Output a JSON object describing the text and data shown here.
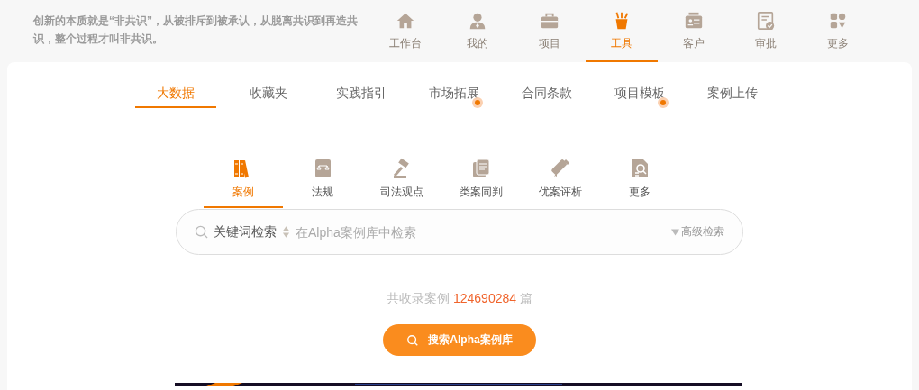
{
  "header": {
    "quote": "创新的本质就是“非共识”，从被排斥到被承认，从脱离共识到再造共识，整个过程才叫非共识。"
  },
  "top_nav": [
    {
      "label": "工作台",
      "selected": false
    },
    {
      "label": "我的",
      "selected": false
    },
    {
      "label": "项目",
      "selected": false
    },
    {
      "label": "工具",
      "selected": true
    },
    {
      "label": "客户",
      "selected": false
    },
    {
      "label": "审批",
      "selected": false
    },
    {
      "label": "更多",
      "selected": false
    }
  ],
  "tabs": [
    {
      "label": "大数据",
      "selected": true,
      "dot": false
    },
    {
      "label": "收藏夹",
      "selected": false,
      "dot": false
    },
    {
      "label": "实践指引",
      "selected": false,
      "dot": false
    },
    {
      "label": "市场拓展",
      "selected": false,
      "dot": true
    },
    {
      "label": "合同条款",
      "selected": false,
      "dot": false
    },
    {
      "label": "项目模板",
      "selected": false,
      "dot": true
    },
    {
      "label": "案例上传",
      "selected": false,
      "dot": false
    }
  ],
  "categories": [
    {
      "label": "案例",
      "selected": true
    },
    {
      "label": "法规",
      "selected": false
    },
    {
      "label": "司法观点",
      "selected": false
    },
    {
      "label": "类案同判",
      "selected": false
    },
    {
      "label": "优案评析",
      "selected": false
    },
    {
      "label": "更多",
      "selected": false
    }
  ],
  "search": {
    "mode": "关键词检索",
    "placeholder": "在Alpha案例库中检索",
    "advanced": "高级检索"
  },
  "stats": {
    "prefix": "共收录案例",
    "count": "124690284",
    "suffix": "篇"
  },
  "search_button": "搜索Alpha案例库"
}
